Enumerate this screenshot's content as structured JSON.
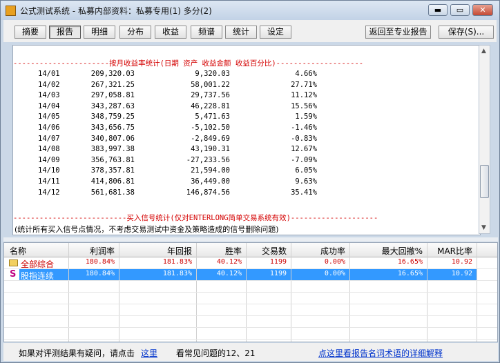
{
  "window": {
    "title": "公式测试系统 - 私募内部资料：私募专用(1) 多分(2)",
    "minimize": "▬",
    "maximize": "▭",
    "close": "✕"
  },
  "toolbar": {
    "tabs": [
      "摘要",
      "报告",
      "明细",
      "分布",
      "收益",
      "频谱",
      "统计",
      "设定"
    ],
    "active_tab": "报告",
    "back_label": "返回至专业报告",
    "save_label": "保存(S)..."
  },
  "report": {
    "monthly_header": "----------------------按月收益率统计(日期 资产 收益金额 收益百分比)--------------------",
    "rows": [
      {
        "date": "14/01",
        "asset": "209,320.03",
        "profit": "9,320.03",
        "pct": "4.66%"
      },
      {
        "date": "14/02",
        "asset": "267,321.25",
        "profit": "58,001.22",
        "pct": "27.71%"
      },
      {
        "date": "14/03",
        "asset": "297,058.81",
        "profit": "29,737.56",
        "pct": "11.12%"
      },
      {
        "date": "14/04",
        "asset": "343,287.63",
        "profit": "46,228.81",
        "pct": "15.56%"
      },
      {
        "date": "14/05",
        "asset": "348,759.25",
        "profit": "5,471.63",
        "pct": "1.59%"
      },
      {
        "date": "14/06",
        "asset": "343,656.75",
        "profit": "-5,102.50",
        "pct": "-1.46%"
      },
      {
        "date": "14/07",
        "asset": "340,807.06",
        "profit": "-2,849.69",
        "pct": "-0.83%"
      },
      {
        "date": "14/08",
        "asset": "383,997.38",
        "profit": "43,190.31",
        "pct": "12.67%"
      },
      {
        "date": "14/09",
        "asset": "356,763.81",
        "profit": "-27,233.56",
        "pct": "-7.09%"
      },
      {
        "date": "14/10",
        "asset": "378,357.81",
        "profit": "21,594.00",
        "pct": "6.05%"
      },
      {
        "date": "14/11",
        "asset": "414,806.81",
        "profit": "36,449.00",
        "pct": "9.63%"
      },
      {
        "date": "14/12",
        "asset": "561,681.38",
        "profit": "146,874.56",
        "pct": "35.41%"
      }
    ],
    "signal_header": "--------------------------买入信号统计(仅对ENTERLONG简单交易系统有效)--------------------",
    "note": "(统计所有买入信号点情况，不考虑交易测试中资金及策略造成的信号删除问题)"
  },
  "grid": {
    "columns": [
      "名称",
      "利润率",
      "年回报",
      "胜率",
      "交易数",
      "成功率",
      "最大回撤%",
      "MAR比率"
    ],
    "rows": [
      {
        "icon": "folder-icon",
        "name": "全部综合",
        "profit": "180.84%",
        "annual": "181.83%",
        "win": "40.12%",
        "trades": "1199",
        "success": "0.00%",
        "drawdown": "16.65%",
        "mar": "10.92",
        "selected": false
      },
      {
        "icon": "s-icon",
        "name": "股指连续",
        "profit": "180.84%",
        "annual": "181.83%",
        "win": "40.12%",
        "trades": "1199",
        "success": "0.00%",
        "drawdown": "16.65%",
        "mar": "10.92",
        "selected": true
      }
    ]
  },
  "status": {
    "text1": "如果对评测结果有疑问，请点击",
    "link1": "这里",
    "text2": "看常见问题的12、21",
    "link2": "点这里看报告名词术语的详细解释"
  }
}
